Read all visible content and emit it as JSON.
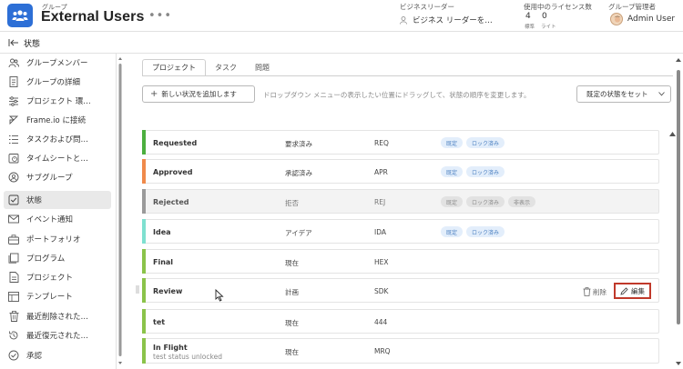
{
  "header": {
    "kicker": "グループ",
    "title": "External Users",
    "more": "•••",
    "business_leader_label": "ビジネスリーダー",
    "business_leader_value": "ビジネス リーダーを…",
    "license_label": "使用中のライセンス数",
    "license_standard_count": "4",
    "license_standard_label": "標準",
    "license_light_count": "0",
    "license_light_label": "ライト",
    "admin_label": "グループ管理者",
    "admin_name": "Admin User"
  },
  "breadcrumb": {
    "title": "状態"
  },
  "sidebar": {
    "items": [
      {
        "label": "グループメンバー",
        "icon": "users-icon"
      },
      {
        "label": "グループの詳細",
        "icon": "document-icon"
      },
      {
        "label": "プロジェクト 環…",
        "icon": "sliders-icon"
      },
      {
        "label": "Frame.io に接続",
        "icon": "frameio-icon"
      },
      {
        "label": "タスクおよび問…",
        "icon": "checklist-icon"
      },
      {
        "label": "タイムシートと…",
        "icon": "clock-icon"
      },
      {
        "label": "サブグループ",
        "icon": "subgroup-icon"
      },
      {
        "label": "状態",
        "icon": "status-check-icon",
        "active": true
      },
      {
        "label": "イベント通知",
        "icon": "envelope-icon"
      },
      {
        "label": "ポートフォリオ",
        "icon": "briefcase-icon"
      },
      {
        "label": "プログラム",
        "icon": "program-icon"
      },
      {
        "label": "プロジェクト",
        "icon": "project-icon"
      },
      {
        "label": "テンプレート",
        "icon": "template-icon"
      },
      {
        "label": "最近削除された…",
        "icon": "trash-icon"
      },
      {
        "label": "最近復元された…",
        "icon": "restore-icon"
      },
      {
        "label": "承認",
        "icon": "approval-icon"
      }
    ]
  },
  "main": {
    "tabs": [
      "プロジェクト",
      "タスク",
      "問題"
    ],
    "add_button": "新しい状況を追加します",
    "add_button_icon": "+",
    "hint": "ドロップダウン メニューの表示したい位置にドラッグして、状態の順序を変更します。",
    "default_button": "既定の状態をセット",
    "rows": [
      {
        "name": "Requested",
        "equates": "要求済み",
        "code": "REQ",
        "tags": [
          "既定",
          "ロック済み"
        ],
        "accent": "#4caf3f",
        "dim": false
      },
      {
        "name": "Approved",
        "equates": "承認済み",
        "code": "APR",
        "tags": [
          "既定",
          "ロック済み"
        ],
        "accent": "#f08a4b",
        "dim": false
      },
      {
        "name": "Rejected",
        "equates": "拒否",
        "code": "REJ",
        "tags": [
          "既定",
          "ロック済み",
          "非表示"
        ],
        "accent": "#9a9a9a",
        "dim": true
      },
      {
        "name": "Idea",
        "equates": "アイデア",
        "code": "IDA",
        "tags": [
          "既定",
          "ロック済み"
        ],
        "accent": "#7fe0d0",
        "dim": false
      },
      {
        "name": "Final",
        "equates": "現在",
        "code": "HEX",
        "tags": [],
        "accent": "#8bc34a",
        "dim": false
      },
      {
        "name": "Review",
        "equates": "計画",
        "code": "SDK",
        "tags": [],
        "accent": "#8bc34a",
        "dim": false,
        "actions": {
          "delete": "削除",
          "edit": "編集"
        }
      },
      {
        "name": "tet",
        "equates": "現在",
        "code": "444",
        "tags": [],
        "accent": "#8bc34a",
        "dim": false
      },
      {
        "name": "In Flight",
        "description": "test status unlocked",
        "equates": "現在",
        "code": "MRQ",
        "tags": [],
        "accent": "#8bc34a",
        "dim": false
      }
    ]
  },
  "colors": {
    "brand": "#2d6fd6",
    "tag_blue_bg": "#e3eefb",
    "tag_blue_text": "#4a7fc0",
    "edit_highlight": "#c0392b"
  }
}
